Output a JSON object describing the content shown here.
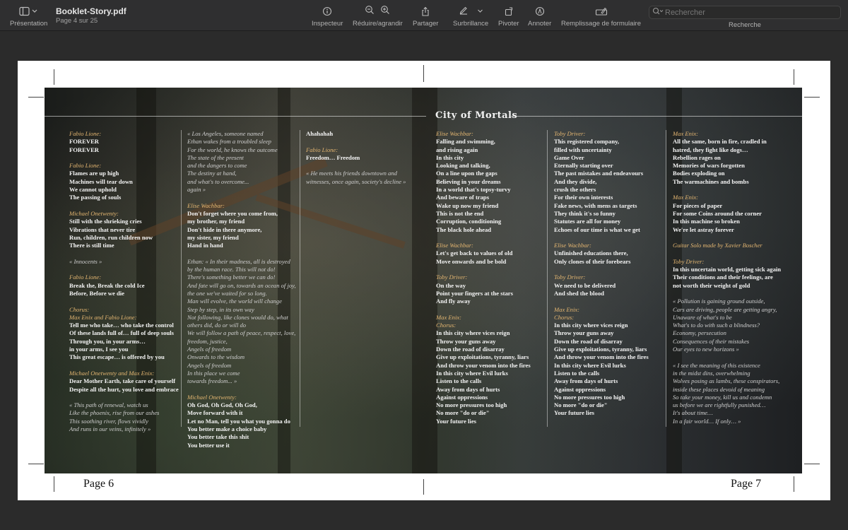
{
  "toolbar": {
    "presentation_label": "Présentation",
    "doc_title": "Booklet-Story.pdf",
    "doc_subtitle": "Page 4 sur 25",
    "inspector_label": "Inspecteur",
    "zoom_label": "Réduire/agrandir",
    "share_label": "Partager",
    "highlight_label": "Surbrillance",
    "rotate_label": "Pivoter",
    "annotate_label": "Annoter",
    "form_label": "Remplissage de formulaire",
    "search_placeholder": "Rechercher",
    "search_label": "Recherche"
  },
  "spread": {
    "title": "City of Mortals",
    "page_left": "Page 6",
    "page_right": "Page 7"
  },
  "columns": [
    [
      [
        {
          "t": "spk",
          "v": "Fabio Lione:"
        },
        {
          "t": "b",
          "v": "FOREVER"
        },
        {
          "t": "b",
          "v": "FOREVER"
        }
      ],
      [
        {
          "t": "spk",
          "v": "Fabio Lione:"
        },
        {
          "t": "b",
          "v": "Flames are up high"
        },
        {
          "t": "b",
          "v": "Machines will tear down"
        },
        {
          "t": "b",
          "v": "We cannot uphold"
        },
        {
          "t": "b",
          "v": "The passing of souls"
        }
      ],
      [
        {
          "t": "spk",
          "v": "Michael Onetwenty:"
        },
        {
          "t": "b",
          "v": "Still with the shrieking cries"
        },
        {
          "t": "b",
          "v": "Vibrations that never tire"
        },
        {
          "t": "b",
          "v": "Run, children, run children now"
        },
        {
          "t": "b",
          "v": "There is still time"
        }
      ],
      [
        {
          "t": "it",
          "v": "« Innocents »"
        }
      ],
      [
        {
          "t": "spk",
          "v": "Fabio Lione:"
        },
        {
          "t": "b",
          "v": "Break the, Break the cold Ice"
        },
        {
          "t": "b",
          "v": "Before, Before we die"
        }
      ],
      [
        {
          "t": "spk",
          "v": "Chorus:"
        },
        {
          "t": "spk",
          "v": "Max Enix and Fabio Lione:"
        },
        {
          "t": "b",
          "v": "Tell me who take… who take the control"
        },
        {
          "t": "b",
          "v": "Of these lands full of… full of deep souls"
        },
        {
          "t": "b",
          "v": "Through you, in your arms…"
        },
        {
          "t": "b",
          "v": "in your arms, I see you"
        },
        {
          "t": "b",
          "v": "This great escape… is offered by you"
        }
      ],
      [
        {
          "t": "spk",
          "v": "Michael Onetwenty and Max Enix:"
        },
        {
          "t": "b",
          "v": "Dear Mother Earth, take care of yourself"
        },
        {
          "t": "b",
          "v": "Despite all the hurt, you love and embrace"
        }
      ],
      [
        {
          "t": "it",
          "v": "« This path of renewal, watch us"
        },
        {
          "t": "it",
          "v": "Like the phoenix, rise from our ashes"
        },
        {
          "t": "it",
          "v": "This soothing river, flows vividly"
        },
        {
          "t": "it",
          "v": "And runs in our veins, infinitely »"
        }
      ]
    ],
    [
      [
        {
          "t": "it",
          "v": "« Los Angeles, someone named"
        },
        {
          "t": "it",
          "v": "Ethan wakes from a troubled sleep"
        },
        {
          "t": "it",
          "v": "For the world, he knows the outcome"
        },
        {
          "t": "it",
          "v": "The state of the present"
        },
        {
          "t": "it",
          "v": "and the dangers to come"
        },
        {
          "t": "it",
          "v": "The destiny at hand,"
        },
        {
          "t": "it",
          "v": "and what's to overcome..."
        },
        {
          "t": "it",
          "v": "again »"
        }
      ],
      [
        {
          "t": "spk",
          "v": "Elise Wachbar:"
        },
        {
          "t": "b",
          "v": "Don't forget where you come from,"
        },
        {
          "t": "b",
          "v": "my brother, my friend"
        },
        {
          "t": "b",
          "v": "Don't hide in there anymore,"
        },
        {
          "t": "b",
          "v": "my sister, my friend"
        },
        {
          "t": "b",
          "v": "Hand in hand"
        }
      ],
      [
        {
          "t": "it",
          "v": "Ethan: « In their madness, all is destroyed"
        },
        {
          "t": "it",
          "v": "by the human race. This will not do!"
        },
        {
          "t": "it",
          "v": "There's something better we can do!"
        },
        {
          "t": "it",
          "v": "And fate will go on, towards an ocean of joy,"
        },
        {
          "t": "it",
          "v": "the one we've waited for so long."
        },
        {
          "t": "it",
          "v": "Man will evolve, the world will change"
        },
        {
          "t": "it",
          "v": "Step by step, in its own way"
        },
        {
          "t": "it",
          "v": "Not following, like clones would do, what"
        },
        {
          "t": "it",
          "v": "others did, do or will do"
        },
        {
          "t": "it",
          "v": "We will follow a path of peace, respect, love,"
        },
        {
          "t": "it",
          "v": "freedom, justice,"
        },
        {
          "t": "it",
          "v": "Angels of freedom"
        },
        {
          "t": "it",
          "v": "Onwards to the wisdom"
        },
        {
          "t": "it",
          "v": "Angels of freedom"
        },
        {
          "t": "it",
          "v": "In this place we come"
        },
        {
          "t": "it",
          "v": "towards freedom... »"
        }
      ],
      [
        {
          "t": "spk",
          "v": "Michael Onetwenty:"
        },
        {
          "t": "b",
          "v": "Oh God, Oh God, Oh God,"
        },
        {
          "t": "b",
          "v": "Move forward with it"
        },
        {
          "t": "b",
          "v": "Let no Man, tell you what you gonna do"
        },
        {
          "t": "b",
          "v": "You better make a choice baby"
        },
        {
          "t": "b",
          "v": "You better take this shit"
        },
        {
          "t": "b",
          "v": "You better use it"
        }
      ]
    ],
    [
      [
        {
          "t": "b",
          "v": "Ahahahah"
        }
      ],
      [
        {
          "t": "spk",
          "v": "Fabio Lione:"
        },
        {
          "t": "b",
          "v": "Freedom… Freedom"
        }
      ],
      [
        {
          "t": "it",
          "v": "« He meets his friends downtown and"
        },
        {
          "t": "it",
          "v": "witnesses, once again, society's decline »"
        }
      ]
    ],
    [
      [
        {
          "t": "spk",
          "v": "Elise Wachbar:"
        },
        {
          "t": "b",
          "v": "Falling and swimming,"
        },
        {
          "t": "b",
          "v": "and rising again"
        },
        {
          "t": "b",
          "v": "In this city"
        },
        {
          "t": "b",
          "v": "Looking and talking,"
        },
        {
          "t": "b",
          "v": "On a line upon the gaps"
        },
        {
          "t": "b",
          "v": "Believing in your dreams"
        },
        {
          "t": "b",
          "v": "In a world that's topsy-turvy"
        },
        {
          "t": "b",
          "v": "And beware of traps"
        },
        {
          "t": "b",
          "v": "Wake up now my friend"
        },
        {
          "t": "b",
          "v": "This is not the end"
        },
        {
          "t": "b",
          "v": "Corruption, conditioning"
        },
        {
          "t": "b",
          "v": "The black hole ahead"
        }
      ],
      [
        {
          "t": "spk",
          "v": "Elise Wachbar:"
        },
        {
          "t": "b",
          "v": "Let's get back to values of old"
        },
        {
          "t": "b",
          "v": "Move onwards and be bold"
        }
      ],
      [
        {
          "t": "spk",
          "v": "Toby Driver:"
        },
        {
          "t": "b",
          "v": "On the way"
        },
        {
          "t": "b",
          "v": "Point your fingers at the stars"
        },
        {
          "t": "b",
          "v": "And fly away"
        }
      ],
      [
        {
          "t": "spk",
          "v": "Max Enix:"
        },
        {
          "t": "spk",
          "v": "Chorus:"
        },
        {
          "t": "b",
          "v": "In this city where vices reign"
        },
        {
          "t": "b",
          "v": "Throw your guns away"
        },
        {
          "t": "b",
          "v": "Down the road of disarray"
        },
        {
          "t": "b",
          "v": "Give up  exploitations, tyranny, liars"
        },
        {
          "t": "b",
          "v": "And throw your venom into the fires"
        },
        {
          "t": "b",
          "v": "In this city where Evil lurks"
        },
        {
          "t": "b",
          "v": "Listen to the calls"
        },
        {
          "t": "b",
          "v": "Away from days of hurts"
        },
        {
          "t": "b",
          "v": "Against oppressions"
        },
        {
          "t": "b",
          "v": "No more pressures too high"
        },
        {
          "t": "b",
          "v": "No more \"do or die\""
        },
        {
          "t": "b",
          "v": "Your future lies"
        }
      ]
    ],
    [
      [
        {
          "t": "spk",
          "v": "Toby Driver:"
        },
        {
          "t": "b",
          "v": "This registered company,"
        },
        {
          "t": "b",
          "v": "filled with uncertainty"
        },
        {
          "t": "b",
          "v": "Game Over"
        },
        {
          "t": "b",
          "v": "Eternally starting over"
        },
        {
          "t": "b",
          "v": "The past mistakes and endeavours"
        },
        {
          "t": "b",
          "v": "And they divide,"
        },
        {
          "t": "b",
          "v": "crush the others"
        },
        {
          "t": "b",
          "v": "For their own interests"
        },
        {
          "t": "b",
          "v": "Fake news, with mens as targets"
        },
        {
          "t": "b",
          "v": "They think it's so funny"
        },
        {
          "t": "b",
          "v": "Statutes are all for money"
        },
        {
          "t": "b",
          "v": "Echoes of our time is what we get"
        }
      ],
      [
        {
          "t": "spk",
          "v": "Elise Wachbar:"
        },
        {
          "t": "b",
          "v": "Unfinished educations there,"
        },
        {
          "t": "b",
          "v": "Only clones of their forebears"
        }
      ],
      [
        {
          "t": "spk",
          "v": "Toby Driver:"
        },
        {
          "t": "b",
          "v": "We need to be delivered"
        },
        {
          "t": "b",
          "v": "And shed the blood"
        }
      ],
      [
        {
          "t": "spk",
          "v": "Max Enix:"
        },
        {
          "t": "spk",
          "v": "Chorus:"
        },
        {
          "t": "b",
          "v": "In this city where vices reign"
        },
        {
          "t": "b",
          "v": "Throw your guns away"
        },
        {
          "t": "b",
          "v": "Down the road of disarray"
        },
        {
          "t": "b",
          "v": "Give up  exploitations, tyranny, liars"
        },
        {
          "t": "b",
          "v": "And throw your venom into the fires"
        },
        {
          "t": "b",
          "v": "In this city where Evil lurks"
        },
        {
          "t": "b",
          "v": "Listen to the calls"
        },
        {
          "t": "b",
          "v": "Away from days of hurts"
        },
        {
          "t": "b",
          "v": "Against oppressions"
        },
        {
          "t": "b",
          "v": "No more pressures too high"
        },
        {
          "t": "b",
          "v": "No more \"do or die\""
        },
        {
          "t": "b",
          "v": "Your future lies"
        }
      ]
    ],
    [
      [
        {
          "t": "spk",
          "v": "Max Enix:"
        },
        {
          "t": "b",
          "v": "All the same, born in fire, cradled in"
        },
        {
          "t": "b",
          "v": "hatred, they fight like dogs…"
        },
        {
          "t": "b",
          "v": "Rebellion rages on"
        },
        {
          "t": "b",
          "v": "Memories of wars forgotten"
        },
        {
          "t": "b",
          "v": "Bodies exploding on"
        },
        {
          "t": "b",
          "v": "The warmachines and bombs"
        }
      ],
      [
        {
          "t": "spk",
          "v": "Max Enix:"
        },
        {
          "t": "b",
          "v": "For pieces of paper"
        },
        {
          "t": "b",
          "v": "For some Coins around the corner"
        },
        {
          "t": "b",
          "v": "In this machine so broken"
        },
        {
          "t": "b",
          "v": "We're let astray forever"
        }
      ],
      [
        {
          "t": "spk",
          "v": "Guitar Solo made by Xavier Boscher"
        }
      ],
      [
        {
          "t": "spk",
          "v": "Toby Driver:"
        },
        {
          "t": "b",
          "v": "In this uncertain world, getting sick again"
        },
        {
          "t": "b",
          "v": "Their conditions and their feelings, are"
        },
        {
          "t": "b",
          "v": "not worth their weight of gold"
        }
      ],
      [
        {
          "t": "it",
          "v": "« Pollution is gaining ground outside,"
        },
        {
          "t": "it",
          "v": "Cars are driving, people are getting angry,"
        },
        {
          "t": "it",
          "v": "Unaware of what's to be"
        },
        {
          "t": "it",
          "v": "What's to do with such a blindness?"
        },
        {
          "t": "it",
          "v": "Economy, persecution"
        },
        {
          "t": "it",
          "v": "Consequences of their mistakes"
        },
        {
          "t": "it",
          "v": "Our eyes to new horizons »"
        }
      ],
      [
        {
          "t": "it",
          "v": "« I see the meaning of this existence"
        },
        {
          "t": "it",
          "v": "in the midst dins, overwhelming"
        },
        {
          "t": "it",
          "v": "Wolves posing as lambs, these conspirators,"
        },
        {
          "t": "it",
          "v": "inside these places devoid of meaning"
        },
        {
          "t": "it",
          "v": "So take your money, kill us and condemn"
        },
        {
          "t": "it",
          "v": "us before we are rightfully punished…"
        },
        {
          "t": "it",
          "v": "It's about time…"
        },
        {
          "t": "it",
          "v": "In a fair world… If only… »"
        }
      ]
    ]
  ]
}
